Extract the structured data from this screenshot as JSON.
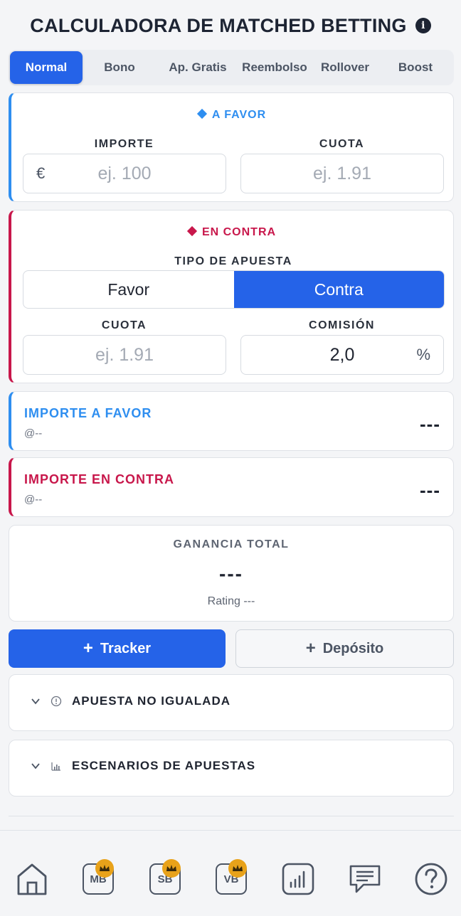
{
  "header": {
    "title": "CALCULADORA DE MATCHED BETTING",
    "info_icon": "info-icon"
  },
  "tabs": [
    {
      "label": "Normal",
      "active": true
    },
    {
      "label": "Bono",
      "active": false
    },
    {
      "label": "Ap. Gratis",
      "active": false
    },
    {
      "label": "Reembolso",
      "active": false
    },
    {
      "label": "Rollover",
      "active": false
    },
    {
      "label": "Boost",
      "active": false
    }
  ],
  "favor": {
    "title": "A FAVOR",
    "importe_label": "IMPORTE",
    "importe_currency": "€",
    "importe_placeholder": "ej. 100",
    "cuota_label": "CUOTA",
    "cuota_placeholder": "ej. 1.91"
  },
  "contra": {
    "title": "EN CONTRA",
    "tipo_label": "TIPO DE APUESTA",
    "tipo_options": [
      "Favor",
      "Contra"
    ],
    "tipo_selected": "Contra",
    "cuota_label": "CUOTA",
    "cuota_placeholder": "ej. 1.91",
    "comision_label": "COMISIÓN",
    "comision_value": "2,0",
    "comision_unit": "%"
  },
  "results": {
    "favor": {
      "title": "IMPORTE A FAVOR",
      "sub": "@--",
      "value": "---"
    },
    "contra": {
      "title": "IMPORTE EN CONTRA",
      "sub": "@--",
      "value": "---"
    }
  },
  "ganancia": {
    "title": "GANANCIA TOTAL",
    "value": "---",
    "rating": "Rating ---"
  },
  "actions": {
    "tracker": "Tracker",
    "deposito": "Depósito"
  },
  "accordions": [
    {
      "label": "APUESTA NO IGUALADA",
      "icon": "alert-circle-icon"
    },
    {
      "label": "ESCENARIOS DE APUESTAS",
      "icon": "bar-chart-icon"
    }
  ],
  "nav": [
    {
      "label": "",
      "icon": "home-icon"
    },
    {
      "label": "MB",
      "icon": "crown-icon"
    },
    {
      "label": "SB",
      "icon": "crown-icon"
    },
    {
      "label": "VB",
      "icon": "crown-icon"
    },
    {
      "label": "",
      "icon": "stats-icon"
    },
    {
      "label": "",
      "icon": "chat-icon"
    },
    {
      "label": "",
      "icon": "help-icon"
    }
  ],
  "colors": {
    "primary": "#2563e8",
    "favor": "#2e8ef0",
    "contra": "#c8174b",
    "crown": "#e8a21a"
  }
}
